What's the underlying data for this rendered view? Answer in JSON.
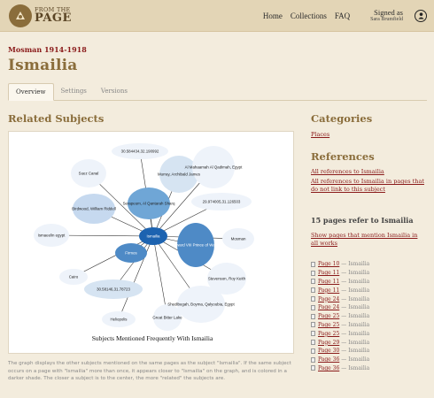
{
  "header": {
    "logo_small": "FROM THE",
    "logo_big": "PAGE",
    "nav": [
      "Home",
      "Collections",
      "FAQ"
    ],
    "signed_as": "Signed as",
    "user": "Sara Brumfield"
  },
  "breadcrumb": "Mosman 1914-1918",
  "title": "Ismailia",
  "tabs": [
    "Overview",
    "Settings",
    "Versions"
  ],
  "related": {
    "heading": "Related Subjects",
    "caption": "Subjects Mentioned Frequently With Ismailia",
    "center": "Ismailia",
    "nodes": [
      "30.584434,32.190992",
      "Suez Canal",
      "Murray, Archibald James",
      "Al Mahaamah Al Qadimah, Egypt",
      "Serapeum, Al Qantarah Sharq",
      "29.974005,31.126503",
      "Birdwood, William Riddell",
      "Ismaeelin egypt",
      "Edward VIII Prince of Wales",
      "Mosman",
      "Firmos",
      "Stevenson, Roy Keith",
      "Cairo",
      "30.58146,31.78723",
      "Shedibegah, Boyma, Qalyoubia, Egypt",
      "Heliopolis",
      "Great Bitter Lake"
    ]
  },
  "description": "The graph displays the other subjects mentioned on the same pages as the subject \"Ismailia\". If the same subject occurs on a page with \"Ismailia\" more than once, it appears closer to \"Ismailia\" on the graph, and is colored in a darker shade. The closer a subject is to the center, the more \"related\" the subjects are.",
  "categories": {
    "heading": "Categories",
    "items": [
      "Places"
    ]
  },
  "references": {
    "heading": "References",
    "all": "All references to Ismailia",
    "not_linked": "All references to Ismailia in pages that do not link to this subject"
  },
  "pages": {
    "count_text": "15 pages refer to Ismailia",
    "show_link": "Show pages that mention Ismailia in all works",
    "items": [
      {
        "page": "Page 10",
        "subject": "— Ismailia"
      },
      {
        "page": "Page 11",
        "subject": "— Ismailia"
      },
      {
        "page": "Page 11",
        "subject": "— Ismailia"
      },
      {
        "page": "Page 11",
        "subject": "— Ismailia"
      },
      {
        "page": "Page 24",
        "subject": "— Ismailia"
      },
      {
        "page": "Page 24",
        "subject": "— Ismailia"
      },
      {
        "page": "Page 25",
        "subject": "— Ismailia"
      },
      {
        "page": "Page 25",
        "subject": "— Ismailia"
      },
      {
        "page": "Page 25",
        "subject": "— Ismailia"
      },
      {
        "page": "Page 29",
        "subject": "— Ismailia"
      },
      {
        "page": "Page 30",
        "subject": "— Ismailia"
      },
      {
        "page": "Page 36",
        "subject": "— Ismailia"
      },
      {
        "page": "Page 36",
        "subject": "— Ismailia"
      }
    ]
  }
}
